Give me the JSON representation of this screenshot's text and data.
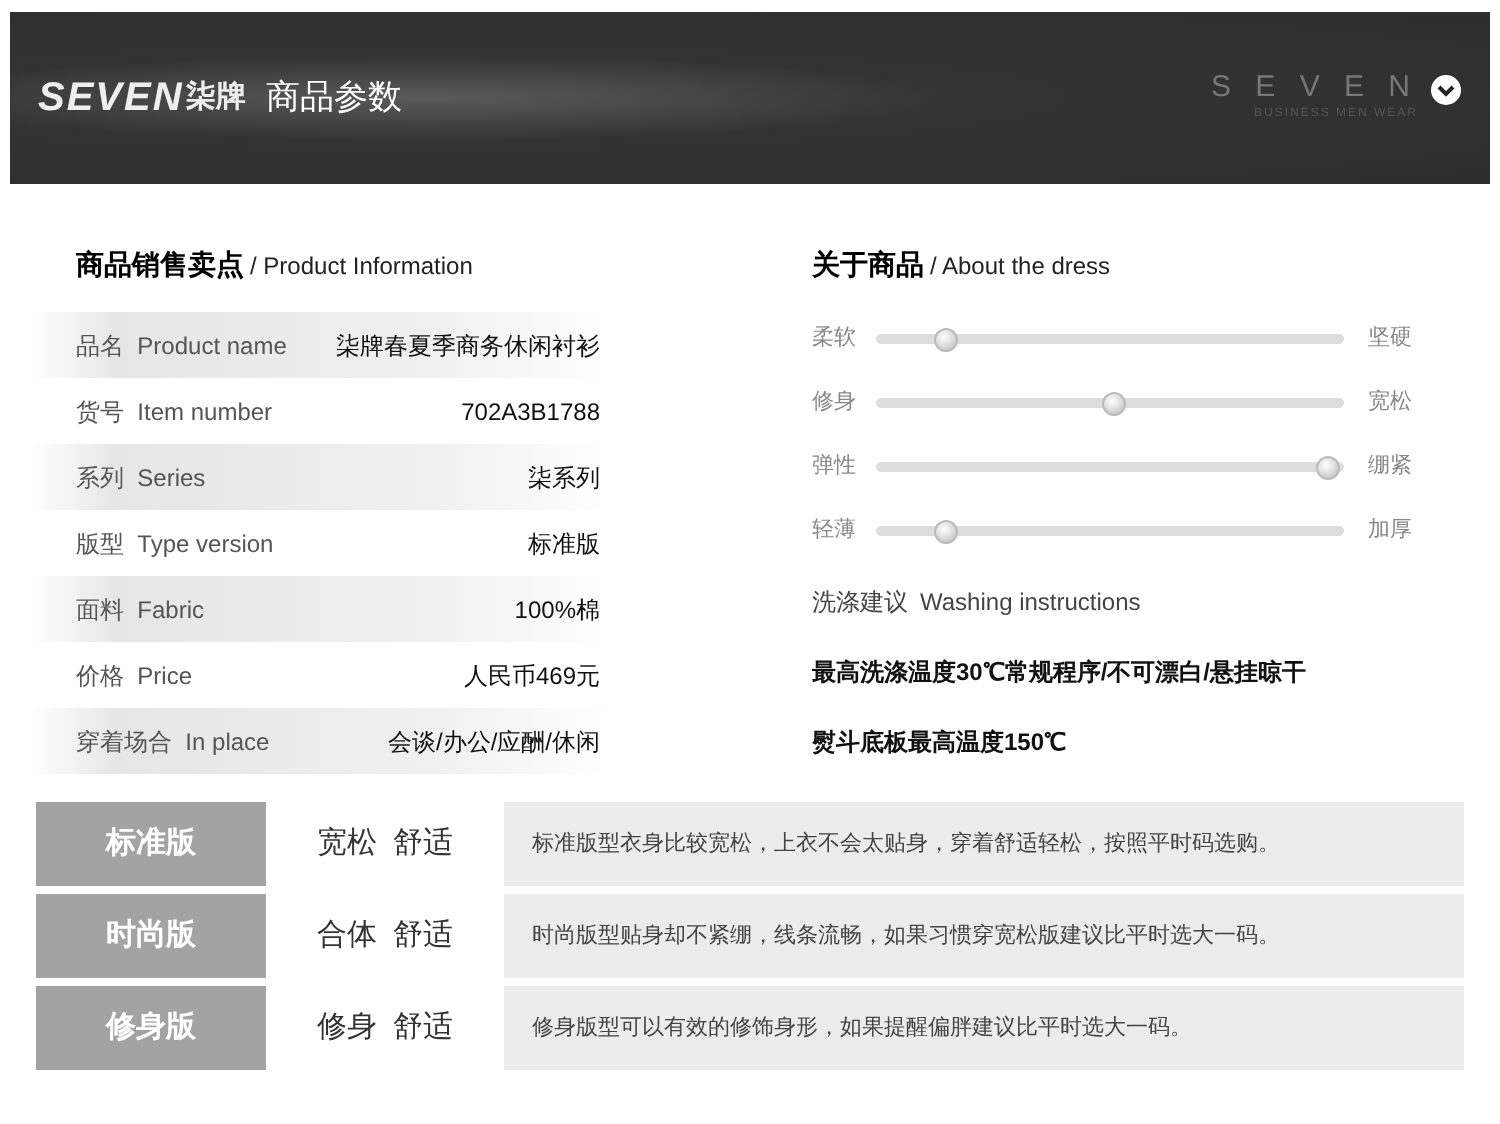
{
  "header": {
    "logo_text": "SEVEN",
    "logo_brand": "柒牌",
    "title": "商品参数",
    "brand": "S E V E N",
    "tagline": "BUSINESS MEN WEAR"
  },
  "product_info": {
    "title_cn": "商品销售卖点",
    "title_en": "/ Product Information",
    "rows": [
      {
        "label_cn": "品名",
        "label_en": "Product name",
        "value": "柒牌春夏季商务休闲衬衫"
      },
      {
        "label_cn": "货号",
        "label_en": "Item number",
        "value": "702A3B1788"
      },
      {
        "label_cn": "系列",
        "label_en": "Series",
        "value": "柒系列"
      },
      {
        "label_cn": "版型",
        "label_en": "Type version",
        "value": "标准版"
      },
      {
        "label_cn": "面料",
        "label_en": "Fabric",
        "value": "100%棉"
      },
      {
        "label_cn": "价格",
        "label_en": "Price",
        "value": "人民币469元"
      },
      {
        "label_cn": "穿着场合",
        "label_en": "In place",
        "value": "会谈/办公/应酬/休闲"
      }
    ]
  },
  "about": {
    "title_cn": "关于商品",
    "title_en": "/ About the dress",
    "scales": [
      {
        "left": "柔软",
        "right": "坚硬",
        "level": 0.13
      },
      {
        "left": "修身",
        "right": "宽松",
        "level": 0.51
      },
      {
        "left": "弹性",
        "right": "绷紧",
        "level": 0.99
      },
      {
        "left": "轻薄",
        "right": "加厚",
        "level": 0.13
      }
    ],
    "washing_cn": "洗涤建议",
    "washing_en": "Washing instructions",
    "instructions": [
      "最高洗涤温度30℃常规程序/不可漂白/悬挂晾干",
      "熨斗底板最高温度150℃"
    ]
  },
  "fits": [
    {
      "name": "标准版",
      "feel": "宽松  舒适",
      "description": "标准版型衣身比较宽松，上衣不会太贴身，穿着舒适轻松，按照平时码选购。"
    },
    {
      "name": "时尚版",
      "feel": "合体  舒适",
      "description": "时尚版型贴身却不紧绷，线条流畅，如果习惯穿宽松版建议比平时选大一码。"
    },
    {
      "name": "修身版",
      "feel": "修身  舒适",
      "description": "修身版型可以有效的修饰身形，如果提醒偏胖建议比平时选大一码。"
    }
  ]
}
